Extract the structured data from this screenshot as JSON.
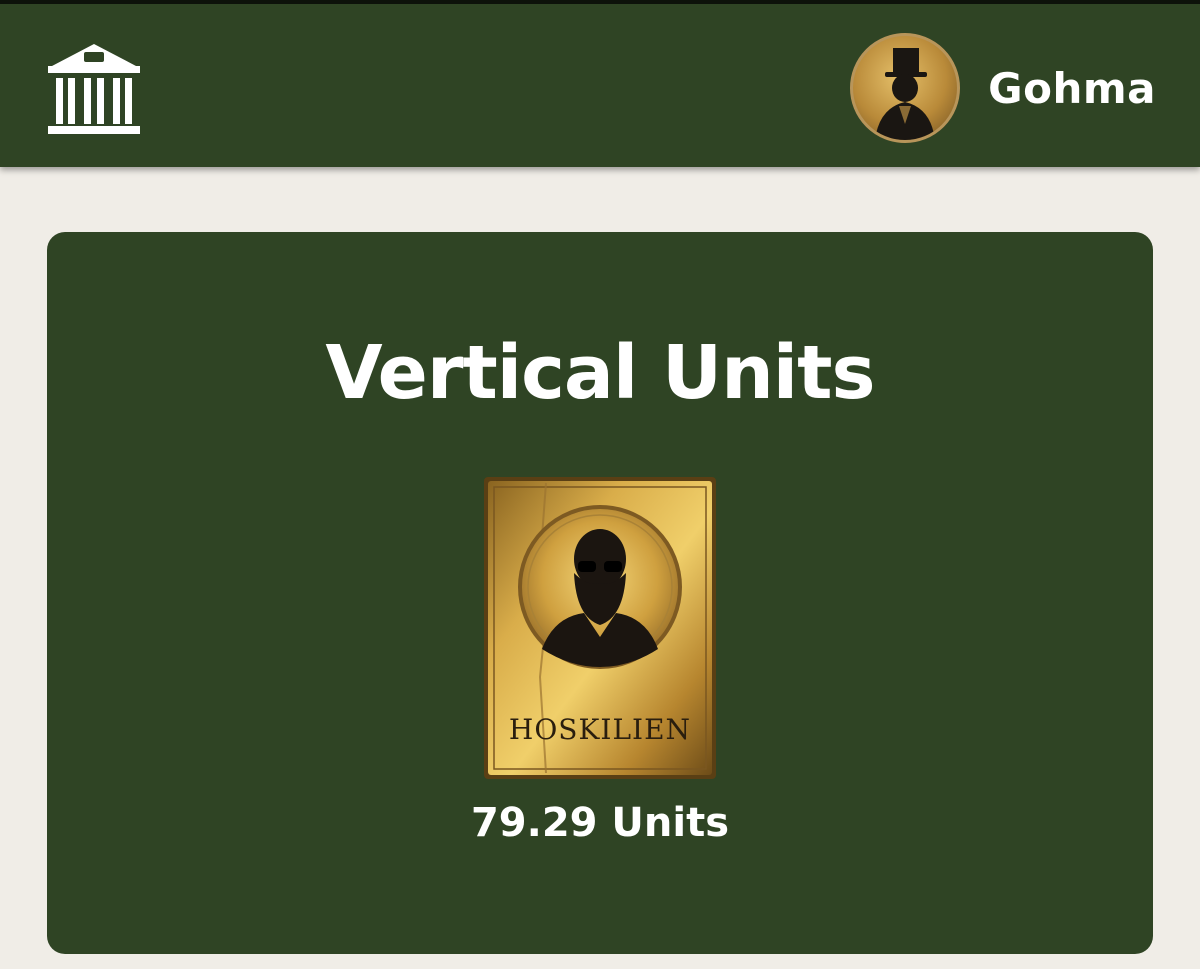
{
  "header": {
    "home_icon": "bank-building-icon",
    "username": "Gohma",
    "avatar_icon": "top-hat-silhouette-avatar"
  },
  "main": {
    "title": "Vertical Units",
    "unit": {
      "card_label": "HOSKILIEN",
      "amount": "79.29 Units"
    }
  },
  "colors": {
    "primary_green": "#2f4424",
    "background": "#f0ede7",
    "gold": "#c9992d",
    "text": "#ffffff"
  }
}
